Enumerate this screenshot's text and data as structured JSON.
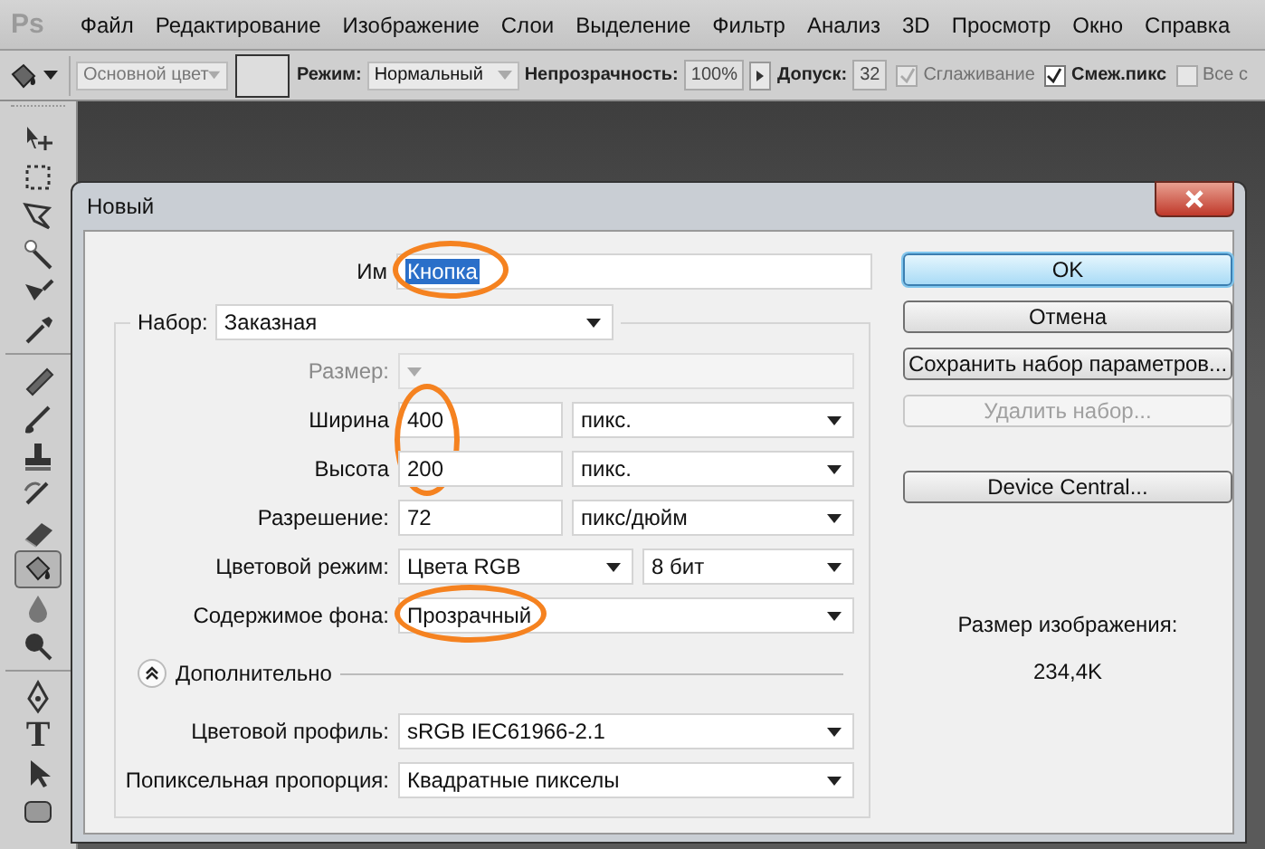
{
  "menu_bar": {
    "logo": "Ps",
    "items": [
      "Файл",
      "Редактирование",
      "Изображение",
      "Слои",
      "Выделение",
      "Фильтр",
      "Анализ",
      "3D",
      "Просмотр",
      "Окно",
      "Справка"
    ]
  },
  "options_bar": {
    "fill_source": {
      "value": "Основной цвет",
      "disabled": true
    },
    "mode": {
      "label": "Режим:",
      "value": "Нормальный"
    },
    "opacity": {
      "label": "Непрозрачность:",
      "value": "100%"
    },
    "tolerance": {
      "label": "Допуск:",
      "value": "32"
    },
    "checkboxes": [
      {
        "label": "Сглаживание",
        "checked": true,
        "disabled": true
      },
      {
        "label": "Смеж.пикс",
        "checked": true,
        "disabled": false
      },
      {
        "label": "Все с",
        "checked": false,
        "disabled": true
      }
    ]
  },
  "tool_groups": [
    [
      {
        "selected": false
      },
      {
        "selected": false
      },
      {
        "selected": false
      },
      {
        "selected": false
      },
      {
        "selected": false
      },
      {
        "selected": false
      }
    ],
    [
      {
        "selected": false
      },
      {
        "selected": false
      },
      {
        "selected": false
      },
      {
        "selected": false
      },
      {
        "selected": false
      },
      {
        "selected": true
      },
      {
        "selected": false
      },
      {
        "selected": false
      }
    ],
    [
      {
        "selected": false
      },
      {
        "label": "T",
        "selected": false
      },
      {
        "selected": false
      },
      {
        "selected": false
      }
    ]
  ],
  "dialog": {
    "title": "Новый",
    "name": {
      "label": "Им",
      "value": "Кнопка",
      "circled": true
    },
    "preset": {
      "label": "Набор:",
      "value": "Заказная"
    },
    "rows": [
      {
        "kind": "select",
        "label": "Размер:",
        "disabled": true
      },
      {
        "kind": "number_unit",
        "label": "Ширина",
        "value": "400",
        "unit": "пикс.",
        "circled": true
      },
      {
        "kind": "number_unit",
        "label": "Высота",
        "value": "200",
        "unit": "пикс.",
        "circled": true
      },
      {
        "kind": "number_unit",
        "label": "Разрешение:",
        "value": "72",
        "unit": "пикс/дюйм"
      },
      {
        "kind": "select_pair",
        "label": "Цветовой режим:",
        "value": "Цвета RGB",
        "value_2": "8 бит"
      },
      {
        "kind": "select",
        "label": "Содержимое фона:",
        "value": "Прозрачный",
        "disabled": false,
        "circled": true
      }
    ],
    "advanced": {
      "label": "Дополнительно",
      "expanded": true
    },
    "advanced_rows": [
      {
        "kind": "select",
        "label": "Цветовой профиль:",
        "value": "sRGB IEC61966-2.1",
        "disabled": false
      },
      {
        "kind": "select",
        "label": "Попиксельная пропорция:",
        "value": "Квадратные пикселы",
        "disabled": false
      }
    ],
    "buttons": [
      {
        "label": "OK",
        "kind": "default",
        "disabled": false
      },
      {
        "label": "Отмена",
        "kind": "normal",
        "disabled": false
      },
      {
        "label": "Сохранить набор параметров...",
        "kind": "normal",
        "disabled": false
      },
      {
        "label": "Удалить набор...",
        "kind": "normal",
        "disabled": true
      },
      {
        "label": "Device Central...",
        "kind": "separated",
        "disabled": false
      }
    ],
    "image_size": {
      "label": "Размер изображения:",
      "value": "234,4K"
    }
  }
}
